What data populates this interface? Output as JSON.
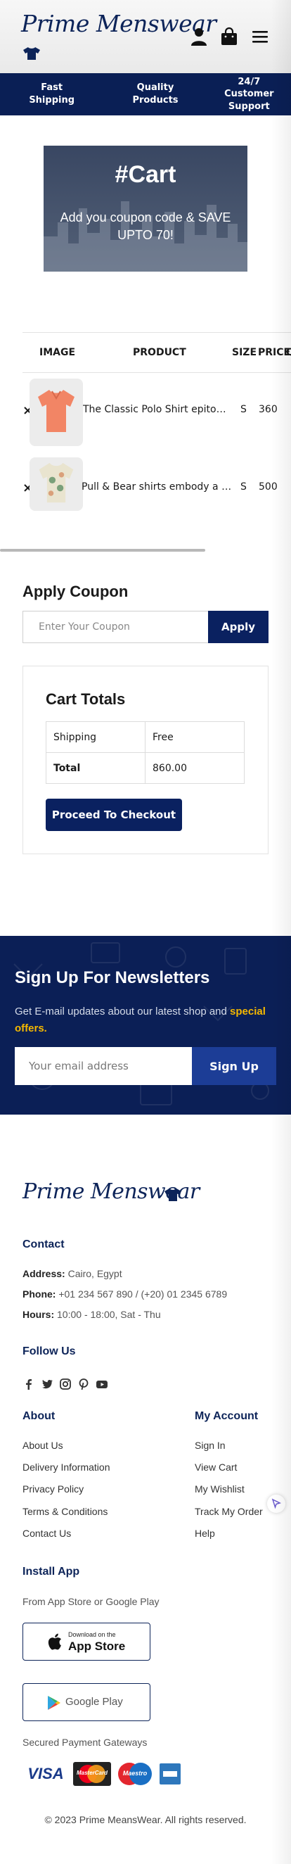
{
  "brand": {
    "name": "Prime Menswear"
  },
  "header": {
    "icons": [
      "user-icon",
      "shopping-bag-icon",
      "menu-icon"
    ]
  },
  "features": [
    "Fast Shipping",
    "Quality Products",
    "24/7 Customer Support"
  ],
  "hero": {
    "title": "#Cart",
    "subtitle": "Add you coupon code & SAVE UPTO 70!"
  },
  "cart": {
    "headers": {
      "image": "IMAGE",
      "product": "PRODUCT",
      "size": "SIZE",
      "price": "PRICE",
      "qty_partial": "Q"
    },
    "remove_symbol": "×",
    "items": [
      {
        "name": "The Classic Polo Shirt epitomizes timeless style",
        "size": "S",
        "price": "360"
      },
      {
        "name": "Pull & Bear shirts embody a fusion of urban style",
        "size": "S",
        "price": "500"
      }
    ]
  },
  "coupon": {
    "title": "Apply Coupon",
    "placeholder": "Enter Your Coupon",
    "button": "Apply"
  },
  "totals": {
    "title": "Cart Totals",
    "rows": [
      {
        "label": "Shipping",
        "value": "Free"
      },
      {
        "label": "Total",
        "value": "860.00"
      }
    ],
    "button": "Proceed To Checkout"
  },
  "newsletter": {
    "title": "Sign Up For Newsletters",
    "desc": "Get E-mail updates about our latest shop and",
    "highlight": "special offers.",
    "placeholder": "Your email address",
    "button": "Sign Up"
  },
  "footer": {
    "contact_heading": "Contact",
    "address_label": "Address:",
    "address": "Cairo, Egypt",
    "phone_label": "Phone:",
    "phone": "+01 234 567 890 / (+20) 01 2345 6789",
    "hours_label": "Hours:",
    "hours": "10:00 - 18:00, Sat - Thu",
    "follow_heading": "Follow Us",
    "about_heading": "About",
    "about_links": [
      "About Us",
      "Delivery Information",
      "Privacy Policy",
      "Terms & Conditions",
      "Contact Us"
    ],
    "account_heading": "My Account",
    "account_links": [
      "Sign In",
      "View Cart",
      "My Wishlist",
      "Track My Order",
      "Help"
    ],
    "install_heading": "Install App",
    "install_text": "From App Store or Google Play",
    "appstore_small": "Download on the",
    "appstore_big": "App Store",
    "googleplay": "Google Play",
    "payment_text": "Secured Payment Gateways",
    "payment_visa": "VISA",
    "payment_mastercard": "MasterCard",
    "payment_maestro": "Maestro",
    "copyright": "© 2023 Prime MeansWear. All rights reserved."
  },
  "colors": {
    "navy": "#0a1f55",
    "button_navy": "#0a2160",
    "accent_yellow": "#f5b800"
  }
}
